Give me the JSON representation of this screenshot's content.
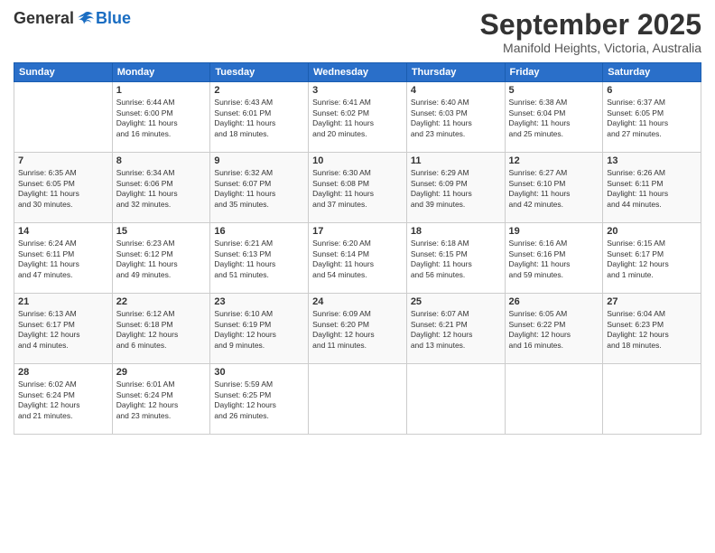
{
  "header": {
    "logo_general": "General",
    "logo_blue": "Blue",
    "month": "September 2025",
    "location": "Manifold Heights, Victoria, Australia"
  },
  "days_of_week": [
    "Sunday",
    "Monday",
    "Tuesday",
    "Wednesday",
    "Thursday",
    "Friday",
    "Saturday"
  ],
  "weeks": [
    [
      {
        "day": "",
        "content": ""
      },
      {
        "day": "1",
        "content": "Sunrise: 6:44 AM\nSunset: 6:00 PM\nDaylight: 11 hours\nand 16 minutes."
      },
      {
        "day": "2",
        "content": "Sunrise: 6:43 AM\nSunset: 6:01 PM\nDaylight: 11 hours\nand 18 minutes."
      },
      {
        "day": "3",
        "content": "Sunrise: 6:41 AM\nSunset: 6:02 PM\nDaylight: 11 hours\nand 20 minutes."
      },
      {
        "day": "4",
        "content": "Sunrise: 6:40 AM\nSunset: 6:03 PM\nDaylight: 11 hours\nand 23 minutes."
      },
      {
        "day": "5",
        "content": "Sunrise: 6:38 AM\nSunset: 6:04 PM\nDaylight: 11 hours\nand 25 minutes."
      },
      {
        "day": "6",
        "content": "Sunrise: 6:37 AM\nSunset: 6:05 PM\nDaylight: 11 hours\nand 27 minutes."
      }
    ],
    [
      {
        "day": "7",
        "content": "Sunrise: 6:35 AM\nSunset: 6:05 PM\nDaylight: 11 hours\nand 30 minutes."
      },
      {
        "day": "8",
        "content": "Sunrise: 6:34 AM\nSunset: 6:06 PM\nDaylight: 11 hours\nand 32 minutes."
      },
      {
        "day": "9",
        "content": "Sunrise: 6:32 AM\nSunset: 6:07 PM\nDaylight: 11 hours\nand 35 minutes."
      },
      {
        "day": "10",
        "content": "Sunrise: 6:30 AM\nSunset: 6:08 PM\nDaylight: 11 hours\nand 37 minutes."
      },
      {
        "day": "11",
        "content": "Sunrise: 6:29 AM\nSunset: 6:09 PM\nDaylight: 11 hours\nand 39 minutes."
      },
      {
        "day": "12",
        "content": "Sunrise: 6:27 AM\nSunset: 6:10 PM\nDaylight: 11 hours\nand 42 minutes."
      },
      {
        "day": "13",
        "content": "Sunrise: 6:26 AM\nSunset: 6:11 PM\nDaylight: 11 hours\nand 44 minutes."
      }
    ],
    [
      {
        "day": "14",
        "content": "Sunrise: 6:24 AM\nSunset: 6:11 PM\nDaylight: 11 hours\nand 47 minutes."
      },
      {
        "day": "15",
        "content": "Sunrise: 6:23 AM\nSunset: 6:12 PM\nDaylight: 11 hours\nand 49 minutes."
      },
      {
        "day": "16",
        "content": "Sunrise: 6:21 AM\nSunset: 6:13 PM\nDaylight: 11 hours\nand 51 minutes."
      },
      {
        "day": "17",
        "content": "Sunrise: 6:20 AM\nSunset: 6:14 PM\nDaylight: 11 hours\nand 54 minutes."
      },
      {
        "day": "18",
        "content": "Sunrise: 6:18 AM\nSunset: 6:15 PM\nDaylight: 11 hours\nand 56 minutes."
      },
      {
        "day": "19",
        "content": "Sunrise: 6:16 AM\nSunset: 6:16 PM\nDaylight: 11 hours\nand 59 minutes."
      },
      {
        "day": "20",
        "content": "Sunrise: 6:15 AM\nSunset: 6:17 PM\nDaylight: 12 hours\nand 1 minute."
      }
    ],
    [
      {
        "day": "21",
        "content": "Sunrise: 6:13 AM\nSunset: 6:17 PM\nDaylight: 12 hours\nand 4 minutes."
      },
      {
        "day": "22",
        "content": "Sunrise: 6:12 AM\nSunset: 6:18 PM\nDaylight: 12 hours\nand 6 minutes."
      },
      {
        "day": "23",
        "content": "Sunrise: 6:10 AM\nSunset: 6:19 PM\nDaylight: 12 hours\nand 9 minutes."
      },
      {
        "day": "24",
        "content": "Sunrise: 6:09 AM\nSunset: 6:20 PM\nDaylight: 12 hours\nand 11 minutes."
      },
      {
        "day": "25",
        "content": "Sunrise: 6:07 AM\nSunset: 6:21 PM\nDaylight: 12 hours\nand 13 minutes."
      },
      {
        "day": "26",
        "content": "Sunrise: 6:05 AM\nSunset: 6:22 PM\nDaylight: 12 hours\nand 16 minutes."
      },
      {
        "day": "27",
        "content": "Sunrise: 6:04 AM\nSunset: 6:23 PM\nDaylight: 12 hours\nand 18 minutes."
      }
    ],
    [
      {
        "day": "28",
        "content": "Sunrise: 6:02 AM\nSunset: 6:24 PM\nDaylight: 12 hours\nand 21 minutes."
      },
      {
        "day": "29",
        "content": "Sunrise: 6:01 AM\nSunset: 6:24 PM\nDaylight: 12 hours\nand 23 minutes."
      },
      {
        "day": "30",
        "content": "Sunrise: 5:59 AM\nSunset: 6:25 PM\nDaylight: 12 hours\nand 26 minutes."
      },
      {
        "day": "",
        "content": ""
      },
      {
        "day": "",
        "content": ""
      },
      {
        "day": "",
        "content": ""
      },
      {
        "day": "",
        "content": ""
      }
    ]
  ]
}
